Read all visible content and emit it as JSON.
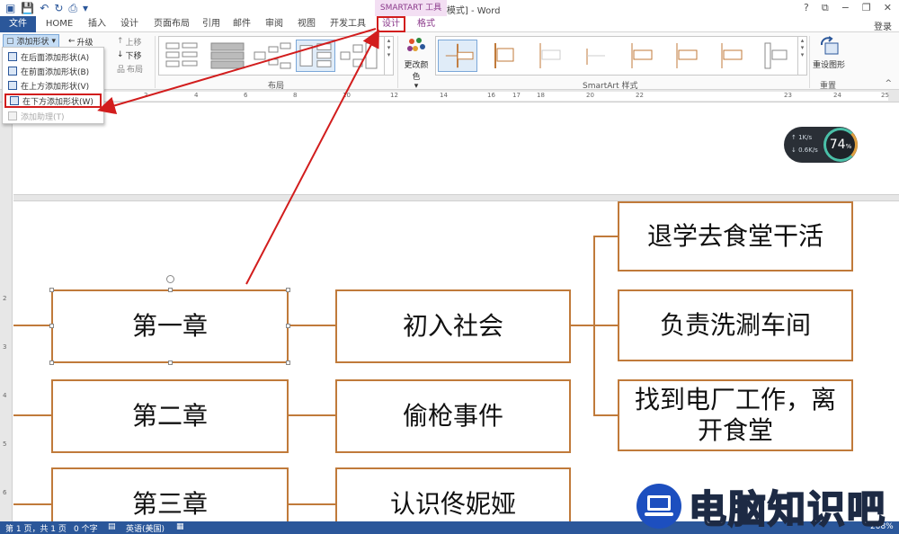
{
  "titlebar": {
    "doc_title": "文档1 [兼容模式] - Word",
    "smartart_tools": "SMARTART 工具",
    "help": "?",
    "restore": "⧉",
    "minimize": "−",
    "maximize": "❐",
    "close": "✕"
  },
  "tabs": {
    "file": "文件",
    "home": "HOME",
    "insert": "插入",
    "design_main": "设计",
    "page_layout": "页面布局",
    "references": "引用",
    "mailings": "邮件",
    "review": "审阅",
    "view": "视图",
    "developer": "开发工具",
    "design": "设计",
    "format": "格式",
    "login": "登录"
  },
  "ribbon": {
    "add_shape": "添加形状",
    "promote": "升级",
    "move_up": "上移",
    "move_down": "下移",
    "layout_btn": "布局",
    "layout_group": "布局",
    "change_colors": "更改颜色",
    "styles_group": "SmartArt 样式",
    "reset_graphic": "重设图形",
    "reset_group": "重置"
  },
  "dropdown": {
    "items": [
      {
        "label": "在后面添加形状(A)"
      },
      {
        "label": "在前面添加形状(B)"
      },
      {
        "label": "在上方添加形状(V)"
      },
      {
        "label": "在下方添加形状(W)"
      },
      {
        "label": "添加助理(T)"
      }
    ]
  },
  "ruler": {
    "numbers": [
      "2",
      "4",
      "6",
      "8",
      "10",
      "12",
      "14",
      "16",
      "17",
      "18",
      "20",
      "22",
      "23",
      "24",
      "25"
    ]
  },
  "vruler": {
    "numbers": [
      "2",
      "3",
      "4",
      "5",
      "6"
    ]
  },
  "smartart": {
    "chapters": [
      "第一章",
      "第二章",
      "第三章"
    ],
    "topics": [
      "初入社会",
      "偷枪事件",
      "认识佟妮娅"
    ],
    "details": [
      "退学去食堂干活",
      "负责洗涮车间",
      "找到电厂工作，离开食堂"
    ]
  },
  "speed_widget": {
    "up": "1K/s",
    "down": "0.6K/s",
    "percent": "74",
    "percent_unit": "%"
  },
  "statusbar": {
    "page": "第 1 页，共 1 页",
    "words": "0 个字",
    "language": "英语(美国)",
    "zoom": "208%"
  },
  "watermark": {
    "text": "电脑知识吧"
  },
  "colors": {
    "accent": "#2b579a",
    "smartart_border": "#c07a3a",
    "highlight_red": "#d21d1d",
    "tools_purple": "#8b3a8b"
  }
}
